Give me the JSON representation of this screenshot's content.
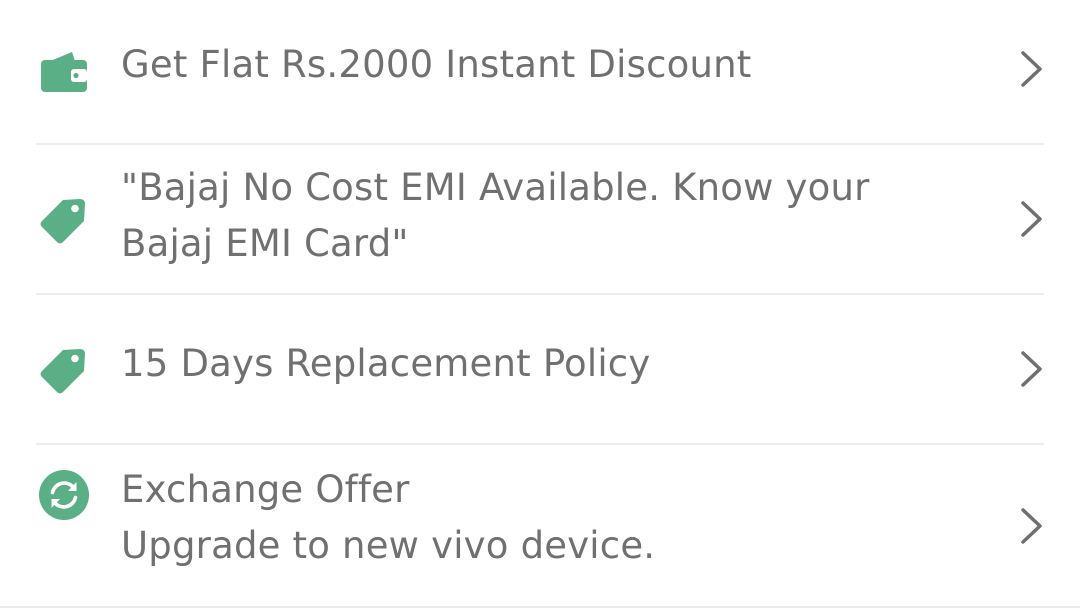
{
  "accent_color": "#5aaf86",
  "text_color": "#707070",
  "offers": [
    {
      "icon": "wallet-icon",
      "lines": [
        "Get Flat Rs.2000 Instant Discount"
      ],
      "chevron": "chevron-right-icon"
    },
    {
      "icon": "tag-icon",
      "lines": [
        "\"Bajaj No Cost EMI Available. Know your",
        "Bajaj EMI Card\""
      ],
      "chevron": "chevron-right-icon"
    },
    {
      "icon": "tag-icon",
      "lines": [
        "15 Days Replacement Policy"
      ],
      "chevron": "chevron-right-icon"
    },
    {
      "icon": "exchange-icon",
      "lines": [
        "Exchange Offer",
        "Upgrade to new vivo device."
      ],
      "chevron": "chevron-right-icon"
    }
  ]
}
